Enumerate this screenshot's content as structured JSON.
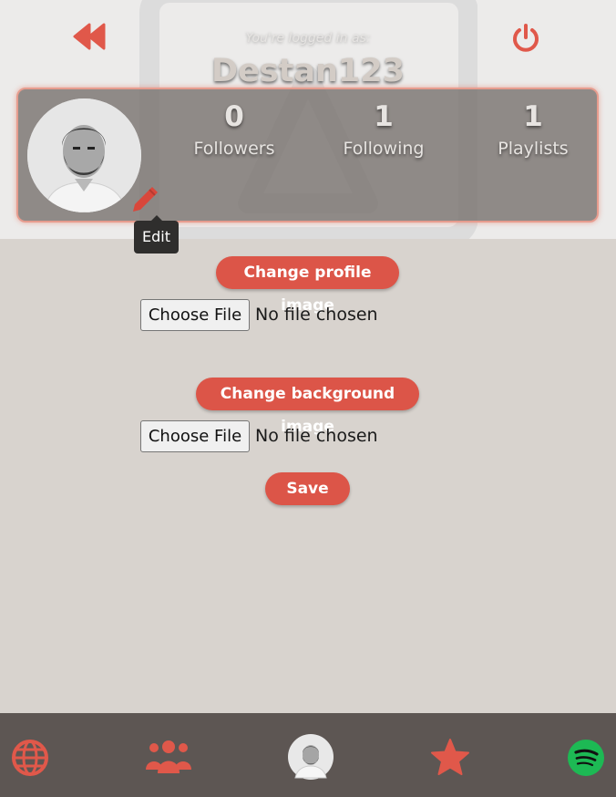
{
  "header": {
    "logged_in_label": "You're logged in as:",
    "username": "Destan123"
  },
  "stats": [
    {
      "value": "0",
      "label": "Followers"
    },
    {
      "value": "1",
      "label": "Following"
    },
    {
      "value": "1",
      "label": "Playlists"
    }
  ],
  "edit_tooltip": "Edit",
  "form": {
    "change_profile_label": "Change profile image",
    "change_background_label": "Change background image",
    "choose_file_label": "Choose File",
    "no_file_label": "No file chosen",
    "save_label": "Save"
  },
  "icons": {
    "back": "rewind-icon",
    "power": "power-icon",
    "edit": "pencil-icon",
    "nav": [
      "globe-icon",
      "users-icon",
      "profile-avatar",
      "star-icon",
      "spotify-icon"
    ]
  },
  "colors": {
    "accent": "#dc5548",
    "page_bg": "#d8d3ce",
    "nav_bg": "#5d5653",
    "spotify": "#1db954"
  }
}
